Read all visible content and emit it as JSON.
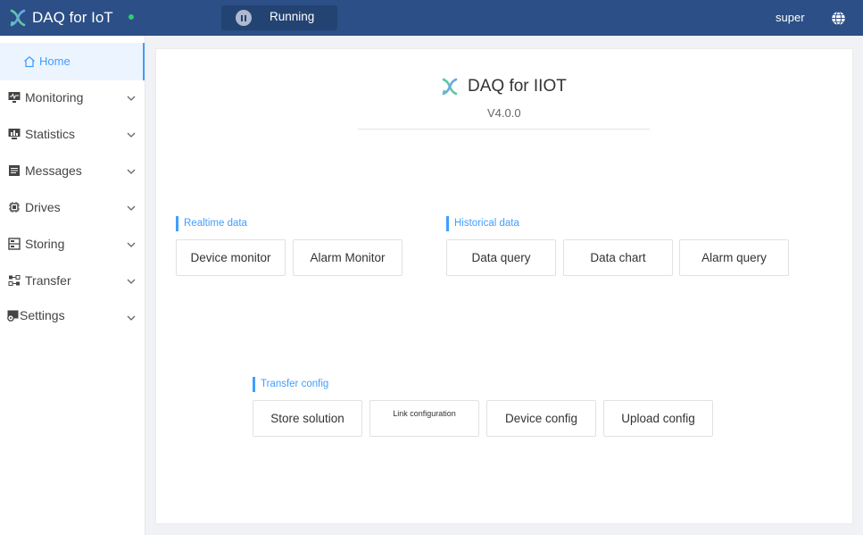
{
  "app": {
    "title": "DAQ for IoT",
    "status_color": "#2ecc71",
    "run_state": "Running",
    "user": "super",
    "header_color": "#2b4f86"
  },
  "sidebar": {
    "items": [
      {
        "label": "Home",
        "icon": "home-icon",
        "active": true
      },
      {
        "label": "Monitoring",
        "icon": "monitor-icon"
      },
      {
        "label": "Statistics",
        "icon": "statistics-icon"
      },
      {
        "label": "Messages",
        "icon": "messages-icon"
      },
      {
        "label": "Drives",
        "icon": "chip-icon"
      },
      {
        "label": "Storing",
        "icon": "storage-icon"
      },
      {
        "label": "Transfer",
        "icon": "transfer-icon"
      },
      {
        "label": "Settings",
        "icon": "settings-icon"
      }
    ]
  },
  "main": {
    "title": "DAQ for IIOT",
    "version": "V4.0.0",
    "sections": {
      "realtime": {
        "label": "Realtime data",
        "buttons": [
          "Device monitor",
          "Alarm Monitor"
        ]
      },
      "historical": {
        "label": "Historical data",
        "buttons": [
          "Data query",
          "Data chart",
          "Alarm query"
        ]
      },
      "transfer": {
        "label": "Transfer config",
        "buttons": [
          "Store solution",
          "Link configuration",
          "Device config",
          "Upload config"
        ]
      }
    }
  }
}
